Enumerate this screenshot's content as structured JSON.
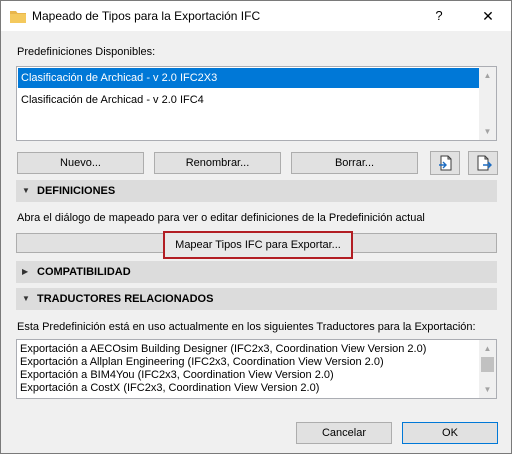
{
  "window": {
    "title": "Mapeado de Tipos para la Exportación IFC",
    "help_label": "?",
    "close_label": "✕"
  },
  "presets": {
    "label": "Predefiniciones Disponibles:",
    "items": [
      {
        "label": "Clasificación de Archicad - v 2.0 IFC2X3",
        "selected": true
      },
      {
        "label": "Clasificación de Archicad - v 2.0 IFC4",
        "selected": false
      }
    ]
  },
  "buttons": {
    "new": "Nuevo...",
    "rename": "Renombrar...",
    "delete": "Borrar..."
  },
  "definitions": {
    "title": "DEFINICIONES",
    "description": "Abra el diálogo de mapeado para ver o editar definiciones de la Predefinición actual",
    "map_button": "Mapear Tipos IFC para Exportar..."
  },
  "compatibility": {
    "title": "COMPATIBILIDAD"
  },
  "translators": {
    "title": "TRADUCTORES RELACIONADOS",
    "description": "Esta Predefinición está en uso actualmente en los siguientes Traductores para la Exportación:",
    "items": [
      "Exportación a AECOsim Building Designer (IFC2x3, Coordination View Version 2.0)",
      "Exportación a Allplan Engineering (IFC2x3, Coordination View Version 2.0)",
      "Exportación a BIM4You (IFC2x3, Coordination View Version 2.0)",
      "Exportación a CostX (IFC2x3, Coordination View Version 2.0)"
    ]
  },
  "footer": {
    "cancel": "Cancelar",
    "ok": "OK"
  },
  "colors": {
    "selection": "#0078d7",
    "highlight_border": "#b21d23",
    "section_bg": "#dcdcdc"
  }
}
